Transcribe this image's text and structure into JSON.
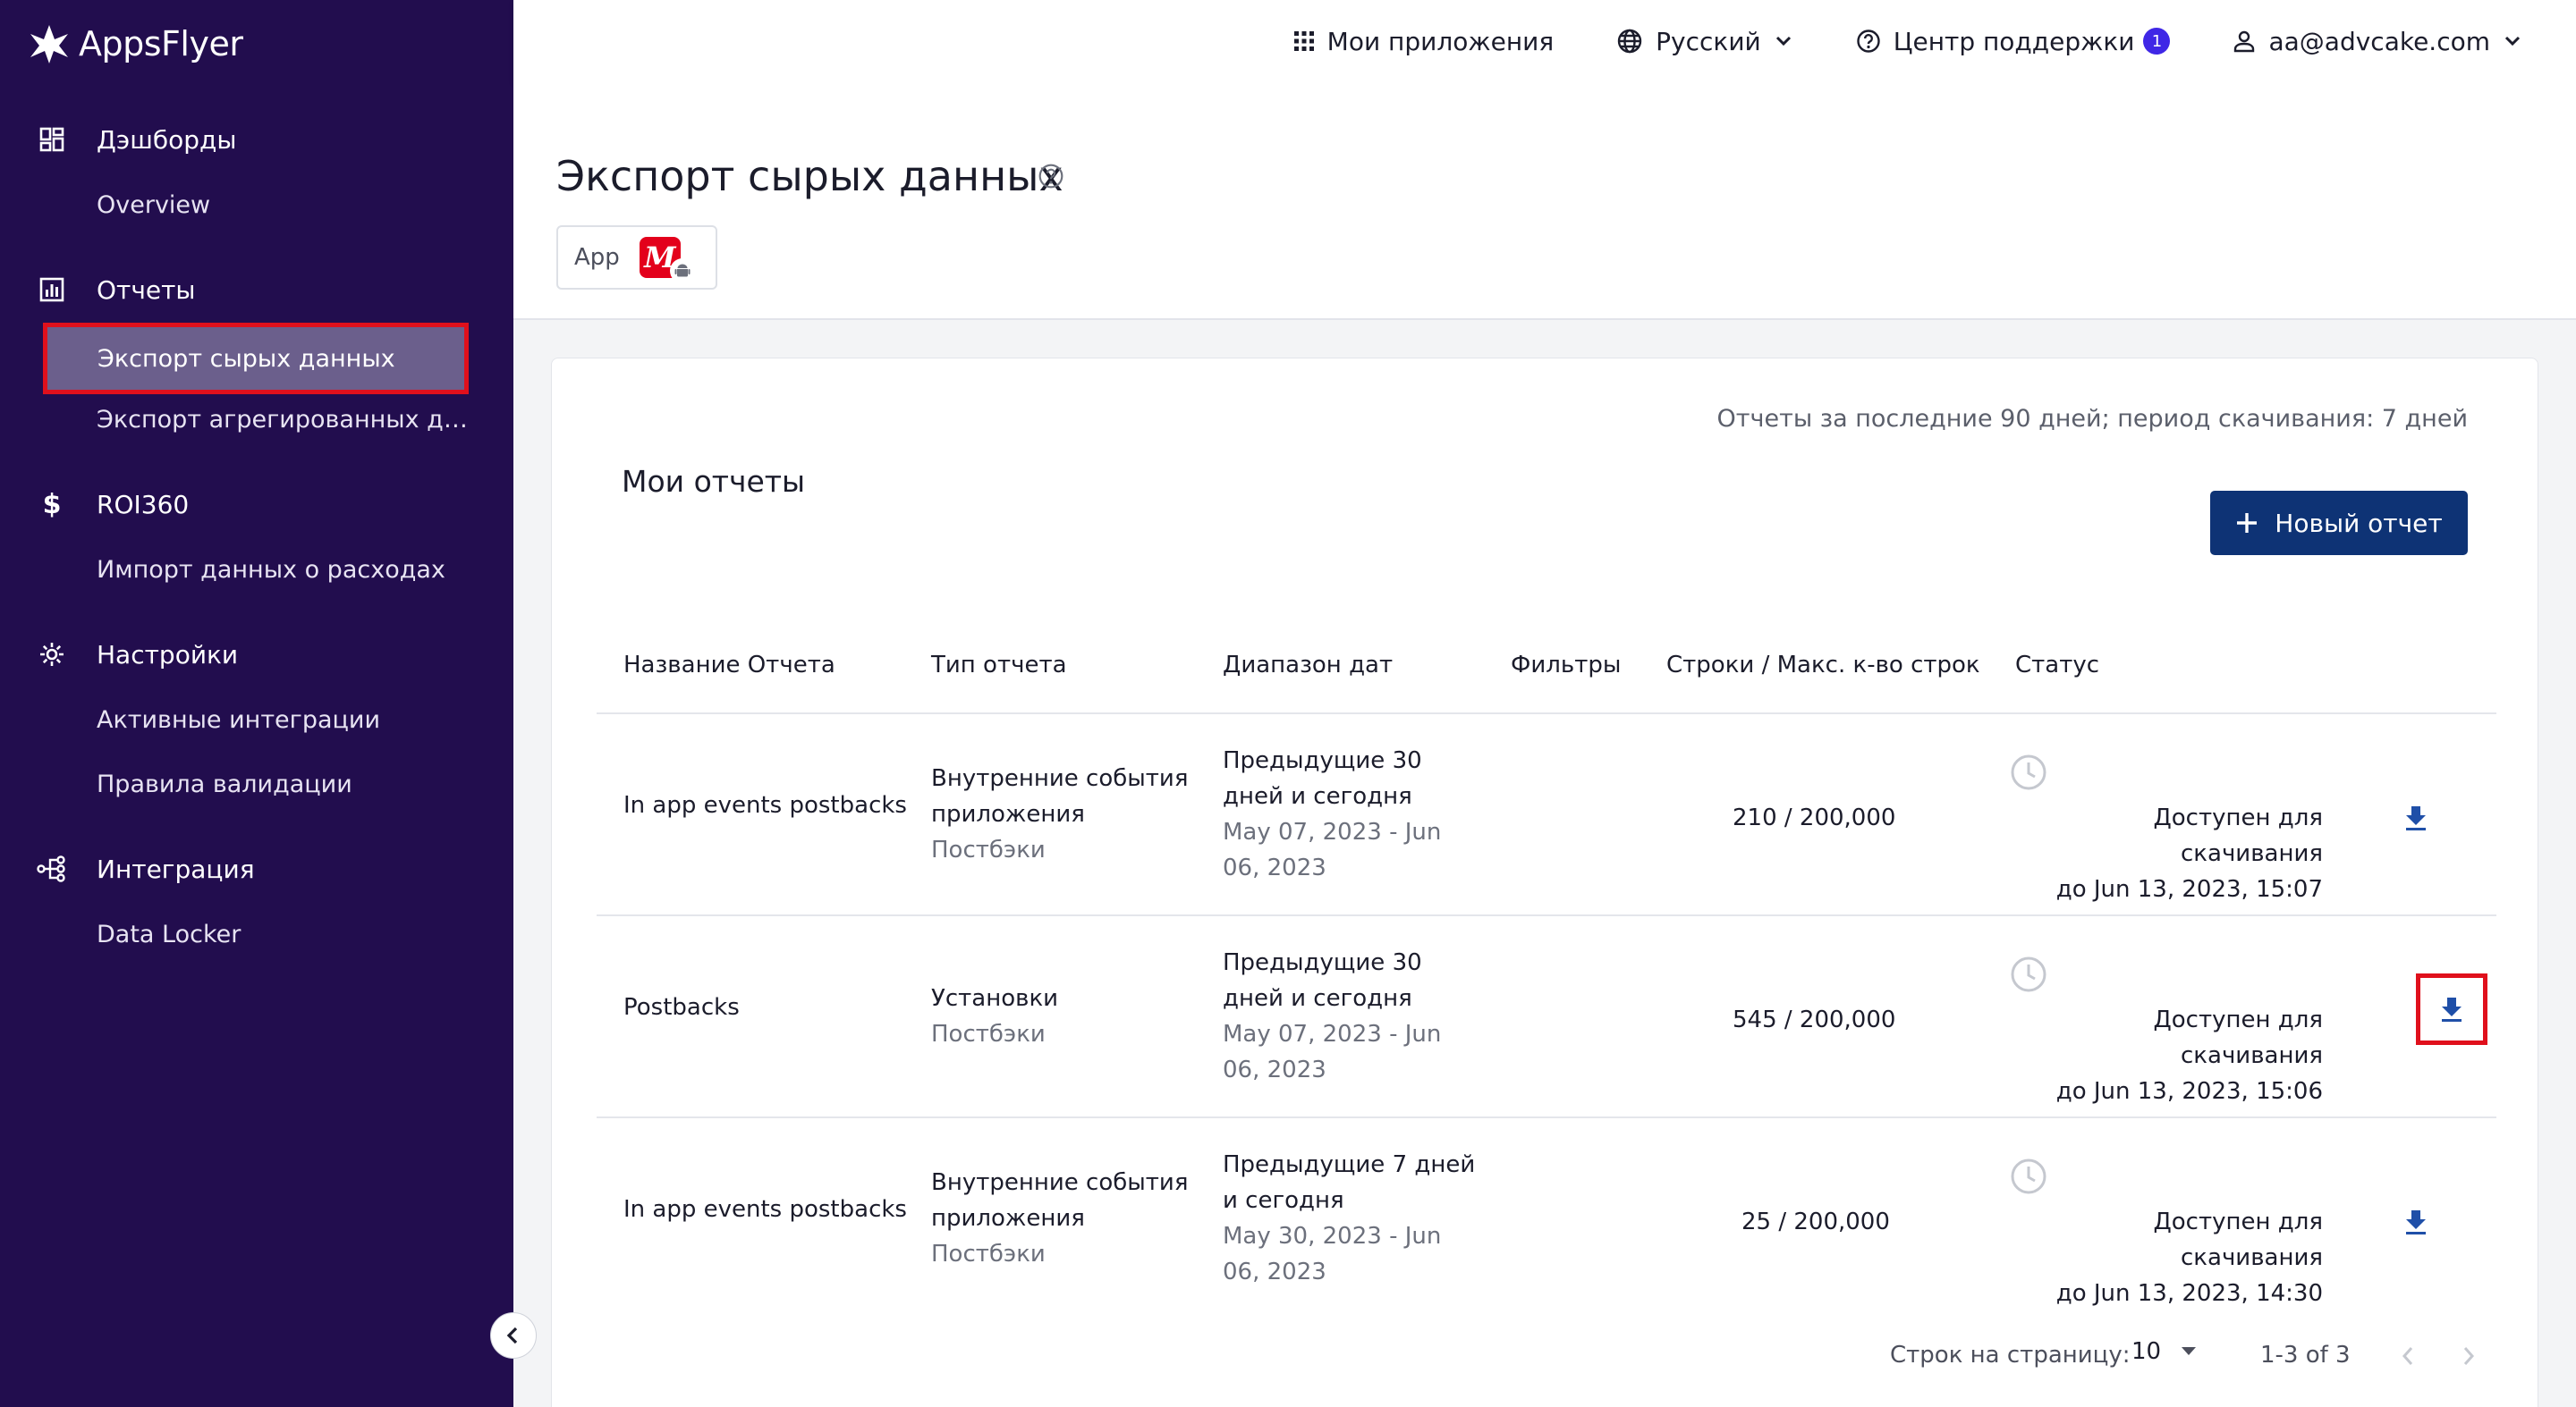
{
  "brand": {
    "name": "AppsFlyer"
  },
  "topbar": {
    "apps": "Мои приложения",
    "language": "Русский",
    "support": "Центр поддержки",
    "support_badge": "1",
    "account": "aa@advcake.com"
  },
  "sidebar": {
    "sections": [
      {
        "label": "Дэшборды",
        "icon": "dashboard-icon",
        "items": [
          "Overview"
        ]
      },
      {
        "label": "Отчеты",
        "icon": "reports-icon",
        "items": [
          "Экспорт сырых данных",
          "Экспорт агрегированных да..."
        ]
      },
      {
        "label": "ROI360",
        "icon": "dollar-icon",
        "items": [
          "Импорт данных о расходах"
        ]
      },
      {
        "label": "Настройки",
        "icon": "gear-icon",
        "items": [
          "Активные интеграции",
          "Правила валидации"
        ]
      },
      {
        "label": "Интеграция",
        "icon": "integration-icon",
        "items": [
          "Data Locker"
        ]
      }
    ],
    "active_item": "Экспорт сырых данных"
  },
  "page": {
    "title": "Экспорт сырых данных",
    "app_label": "App",
    "app_logo_letter": "М"
  },
  "card": {
    "title": "Мои отчеты",
    "period_note": "Отчеты за последние 90 дней; период скачивания: 7 дней",
    "new_button": "Новый отчет"
  },
  "table": {
    "headers": [
      "Название Отчета",
      "Тип отчета",
      "Диапазон дат",
      "Фильтры",
      "Строки / Макс. к-во строк",
      "Статус"
    ],
    "rows": [
      {
        "name": "In app events postbacks",
        "type_line1": "Внутренние события",
        "type_line2": "приложения",
        "type_sub": "Постбэки",
        "range_line1": "Предыдущие 30",
        "range_line2": "дней и сегодня",
        "range_dates1": "May 07, 2023 - Jun",
        "range_dates2": "06, 2023",
        "rows_count": "210 / 200,000",
        "status_line1": "Доступен для скачивания",
        "status_line2": "до Jun 13, 2023, 15:07"
      },
      {
        "name": "Postbacks",
        "type_line1": "Установки",
        "type_line2": "",
        "type_sub": "Постбэки",
        "range_line1": "Предыдущие 30",
        "range_line2": "дней и сегодня",
        "range_dates1": "May 07, 2023 - Jun",
        "range_dates2": "06, 2023",
        "rows_count": "545 / 200,000",
        "status_line1": "Доступен для скачивания",
        "status_line2": "до Jun 13, 2023, 15:06"
      },
      {
        "name": "In app events postbacks",
        "type_line1": "Внутренние события",
        "type_line2": "приложения",
        "type_sub": "Постбэки",
        "range_line1": "Предыдущие 7 дней",
        "range_line2": "и сегодня",
        "range_dates1": "May 30, 2023 - Jun",
        "range_dates2": "06, 2023",
        "rows_count": "25 / 200,000",
        "status_line1": "Доступен для скачивания",
        "status_line2": "до Jun 13, 2023, 14:30"
      }
    ]
  },
  "pagination": {
    "rows_per_page_label": "Строк на страницу:",
    "rows_per_page": "10",
    "range": "1-3 of 3"
  },
  "colors": {
    "sidebar_bg": "#220d4e",
    "primary_button": "#0e3375",
    "highlight_red": "#e0101c",
    "badge": "#3f27e6",
    "download_icon": "#1f4fa8"
  }
}
